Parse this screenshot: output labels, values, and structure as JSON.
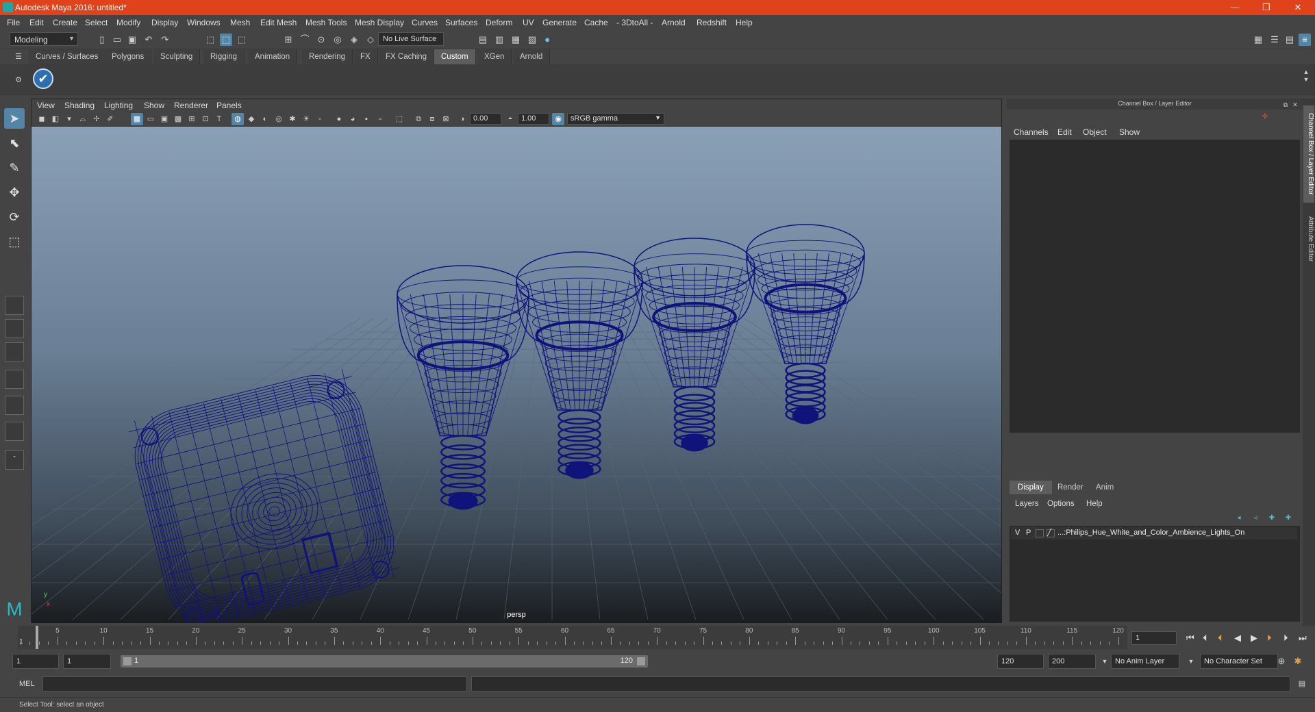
{
  "window": {
    "title": "Autodesk Maya 2016: untitled*",
    "minimize": "—",
    "maximize": "❐",
    "close": "✕"
  },
  "menubar": [
    "File",
    "Edit",
    "Create",
    "Select",
    "Modify",
    "Display",
    "Windows",
    "Mesh",
    "Edit Mesh",
    "Mesh Tools",
    "Mesh Display",
    "Curves",
    "Surfaces",
    "Deform",
    "UV",
    "Generate",
    "Cache",
    "- 3DtoAll -",
    "Arnold",
    "Redshift",
    "Help"
  ],
  "statusline": {
    "mode": "Modeling",
    "live_surface": "No Live Surface"
  },
  "shelf": {
    "tabs": [
      "Curves / Surfaces",
      "Polygons",
      "Sculpting",
      "Rigging",
      "Animation",
      "Rendering",
      "FX",
      "FX Caching",
      "Custom",
      "XGen",
      "Arnold"
    ],
    "active_tab": "Custom"
  },
  "viewport": {
    "menu": [
      "View",
      "Shading",
      "Lighting",
      "Show",
      "Renderer",
      "Panels"
    ],
    "exposure": "0.00",
    "gamma": "1.00",
    "color_space": "sRGB gamma",
    "camera": "persp",
    "wire_color": "#10137a"
  },
  "channelbox": {
    "header": "Channel Box / Layer Editor",
    "menu": [
      "Channels",
      "Edit",
      "Object",
      "Show"
    ],
    "layer_tabs": [
      "Display",
      "Render",
      "Anim"
    ],
    "active_layer_tab": "Display",
    "layer_menu": [
      "Layers",
      "Options",
      "Help"
    ],
    "layer": {
      "v": "V",
      "p": "P",
      "name": "...:Philips_Hue_White_and_Color_Ambience_Lights_On"
    },
    "side_tabs": [
      "Channel Box / Layer Editor",
      "Attribute Editor"
    ]
  },
  "timeslider": {
    "ticks": [
      "5",
      "10",
      "15",
      "20",
      "25",
      "30",
      "35",
      "40",
      "45",
      "50",
      "55",
      "60",
      "65",
      "70",
      "75",
      "80",
      "85",
      "90",
      "95",
      "100",
      "105",
      "110",
      "115",
      "120"
    ],
    "current_frame": "1",
    "frame_field": "1"
  },
  "rangeslider": {
    "start": "1",
    "start_inner": "1",
    "range_start": "1",
    "range_end": "120",
    "end_inner": "120",
    "end": "200",
    "anim_layer": "No Anim Layer",
    "character_set": "No Character Set"
  },
  "cmdline": {
    "label": "MEL"
  },
  "helpline": {
    "text": "Select Tool: select an object"
  }
}
